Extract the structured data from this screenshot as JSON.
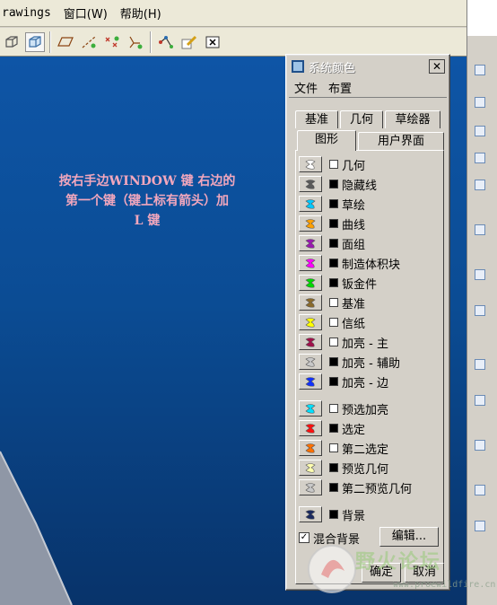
{
  "menubar": {
    "items": [
      "rawings",
      "窗口(W)",
      "帮助(H)"
    ]
  },
  "canvas": {
    "note": "按右手边WINDOW 键  右边的\n第一个键（键上标有箭头）加\nL   键"
  },
  "dialog": {
    "title": "系统颜色",
    "close_label": "✕",
    "menu": [
      "文件",
      "布置"
    ],
    "tabs_row1": [
      "基准",
      "几何",
      "草绘器"
    ],
    "tabs_row2": [
      "图形",
      "用户界面"
    ],
    "active_tab": "图形",
    "color_rows": [
      {
        "label": "几何",
        "checked": false,
        "color": "#ffffff"
      },
      {
        "label": "隐藏线",
        "checked": true,
        "color": "#5a5a5a"
      },
      {
        "label": "草绘",
        "checked": true,
        "color": "#00c8ff"
      },
      {
        "label": "曲线",
        "checked": true,
        "color": "#ffa000"
      },
      {
        "label": "面组",
        "checked": true,
        "color": "#9a1ab0"
      },
      {
        "label": "制造体积块",
        "checked": true,
        "color": "#ff00ff"
      },
      {
        "label": "钣金件",
        "checked": true,
        "color": "#00d800"
      },
      {
        "label": "基准",
        "checked": false,
        "color": "#8a6a2a"
      },
      {
        "label": "信纸",
        "checked": false,
        "color": "#ffff00"
      },
      {
        "label": "加亮 - 主",
        "checked": false,
        "color": "#a0104a"
      },
      {
        "label": "加亮 - 辅助",
        "checked": true,
        "color": "#c8c8c8"
      },
      {
        "label": "加亮 - 边",
        "checked": true,
        "color": "#1030ff"
      },
      {
        "label": "预选加亮",
        "checked": false,
        "color": "#00e0ff"
      },
      {
        "label": "选定",
        "checked": true,
        "color": "#ff1010"
      },
      {
        "label": "第二选定",
        "checked": false,
        "color": "#ff7000"
      },
      {
        "label": "预览几何",
        "checked": true,
        "color": "#ffffb0"
      },
      {
        "label": "第二预览几何",
        "checked": true,
        "color": "#c8c8c8"
      },
      {
        "label": "背景",
        "checked": true,
        "color": "#1a2a60"
      }
    ],
    "mix_background_label": "混合背景",
    "mix_checkmark": "✓",
    "edit_button": "编辑...",
    "ok_button": "确定",
    "cancel_button": "取消"
  },
  "watermark": {
    "text": "野火论坛",
    "url": "www.proewildfire.cn"
  }
}
